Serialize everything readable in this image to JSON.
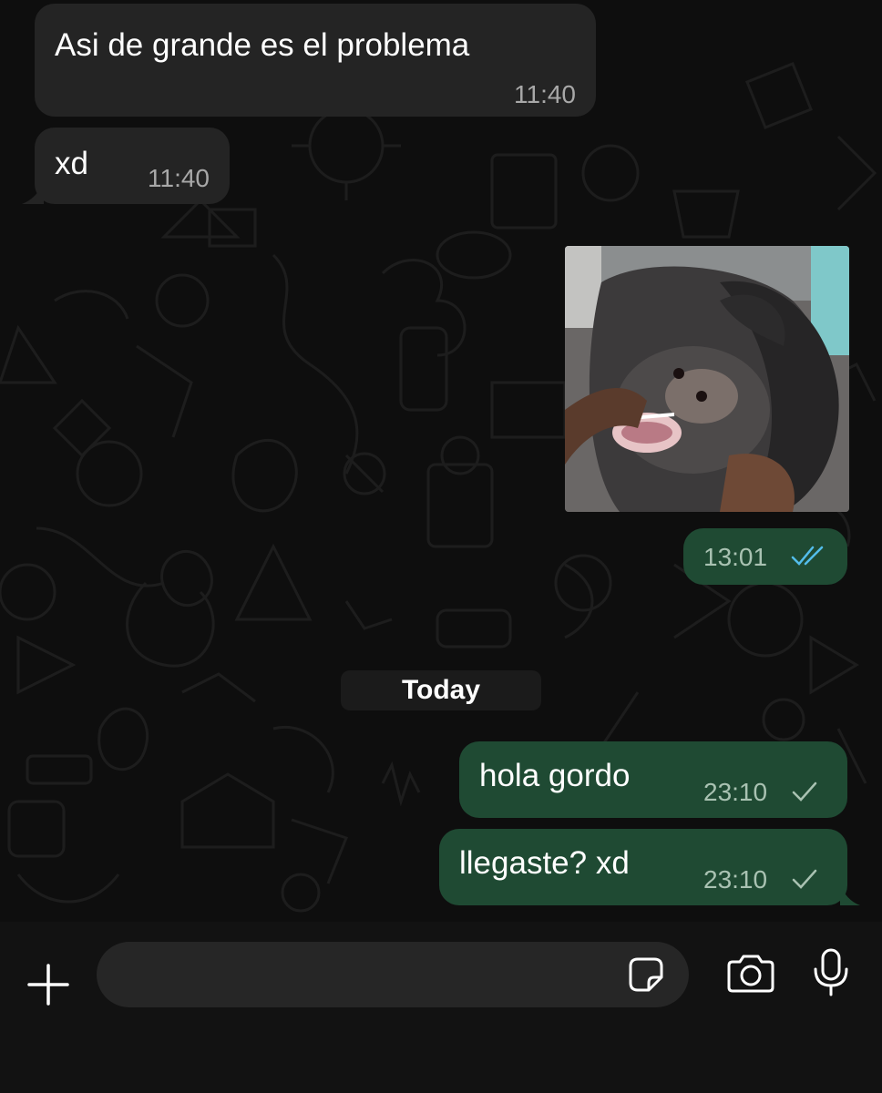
{
  "messages": [
    {
      "direction": "in",
      "text": "Asi de grande es el problema",
      "time": "11:40"
    },
    {
      "direction": "in",
      "text": "xd",
      "time": "11:40"
    },
    {
      "direction": "out",
      "type": "image",
      "image_desc": "monkey-photo",
      "time": "13:01",
      "status": "read"
    },
    {
      "direction": "out",
      "text": "hola gordo",
      "time": "23:10",
      "status": "sent"
    },
    {
      "direction": "out",
      "text": "llegaste? xd",
      "time": "23:10",
      "status": "sent"
    }
  ],
  "date_divider": "Today",
  "composer": {
    "placeholder": "",
    "icons": [
      "plus-icon",
      "sticker-icon",
      "camera-icon",
      "microphone-icon"
    ]
  },
  "colors": {
    "incoming_bubble": "#242424",
    "outgoing_bubble": "#1f4a33",
    "read_check": "#53bdeb",
    "background": "#0e0e0e"
  }
}
